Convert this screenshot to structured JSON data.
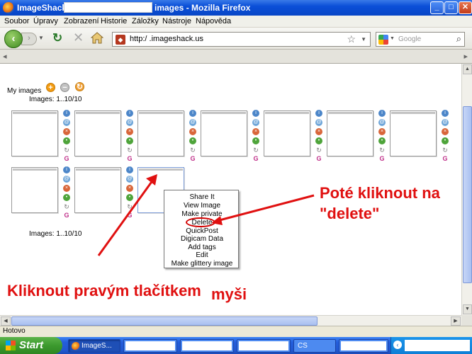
{
  "window": {
    "title_prefix": "ImageShack®",
    "title_suffix": "images - Mozilla Firefox",
    "minimize": "_",
    "maximize": "□",
    "close": "✕"
  },
  "menu": [
    "Soubor",
    "Úpravy",
    "Zobrazení",
    "Historie",
    "Záložky",
    "Nástroje",
    "Nápověda"
  ],
  "nav": {
    "url": "http:/        .imageshack.us",
    "search_placeholder": "Google"
  },
  "page": {
    "my_images_label": "My images",
    "count_top": "Images: 1..10/10",
    "count_bottom": "Images: 1..10/10"
  },
  "context_menu": {
    "items": [
      "Share It",
      "View Image",
      "Make private",
      "Delete",
      "QuickPost",
      "Digicam Data",
      "Add tags",
      "Edit",
      "Make glittery image"
    ]
  },
  "annotations": {
    "note_right": "Poté kliknout na \"delete\"",
    "note_bottom_main": "Kliknout pravým tlačítkem",
    "note_bottom_end": "myši",
    "color": "#e01010"
  },
  "status": {
    "text": "Hotovo"
  },
  "taskbar": {
    "start": "Start",
    "firefox_task": "ImageS...",
    "cs_label": "CS"
  }
}
